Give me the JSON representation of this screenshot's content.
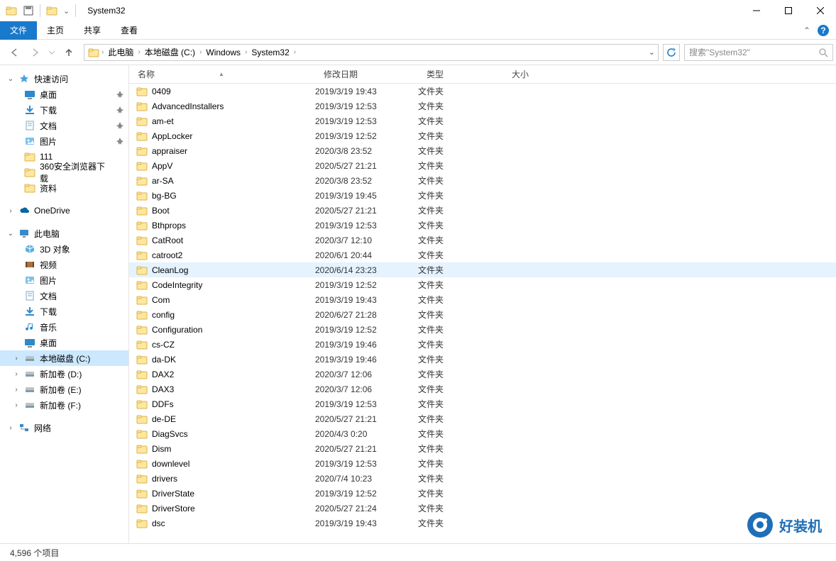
{
  "window": {
    "title": "System32"
  },
  "ribbon": {
    "file": "文件",
    "home": "主页",
    "share": "共享",
    "view": "查看"
  },
  "nav": {
    "breadcrumb": [
      "此电脑",
      "本地磁盘 (C:)",
      "Windows",
      "System32"
    ],
    "search_placeholder": "搜索\"System32\""
  },
  "sidebar": {
    "quick": {
      "label": "快速访问",
      "items": [
        {
          "label": "桌面",
          "icon": "desktop",
          "pinned": true
        },
        {
          "label": "下载",
          "icon": "downloads",
          "pinned": true
        },
        {
          "label": "文档",
          "icon": "documents",
          "pinned": true
        },
        {
          "label": "图片",
          "icon": "pictures",
          "pinned": true
        },
        {
          "label": "111",
          "icon": "folder",
          "pinned": false
        },
        {
          "label": "360安全浏览器下载",
          "icon": "folder",
          "pinned": false
        },
        {
          "label": "资料",
          "icon": "folder",
          "pinned": false
        }
      ]
    },
    "onedrive": {
      "label": "OneDrive"
    },
    "thispc": {
      "label": "此电脑",
      "items": [
        {
          "label": "3D 对象",
          "icon": "3d"
        },
        {
          "label": "视频",
          "icon": "video"
        },
        {
          "label": "图片",
          "icon": "pictures"
        },
        {
          "label": "文档",
          "icon": "documents"
        },
        {
          "label": "下载",
          "icon": "downloads"
        },
        {
          "label": "音乐",
          "icon": "music"
        },
        {
          "label": "桌面",
          "icon": "desktop"
        },
        {
          "label": "本地磁盘 (C:)",
          "icon": "drive",
          "selected": true
        },
        {
          "label": "新加卷 (D:)",
          "icon": "drive"
        },
        {
          "label": "新加卷 (E:)",
          "icon": "drive"
        },
        {
          "label": "新加卷 (F:)",
          "icon": "drive"
        }
      ]
    },
    "network": {
      "label": "网络"
    }
  },
  "columns": {
    "name": "名称",
    "date": "修改日期",
    "type": "类型",
    "size": "大小"
  },
  "rows": [
    {
      "name": "0409",
      "date": "2019/3/19 19:43",
      "type": "文件夹"
    },
    {
      "name": "AdvancedInstallers",
      "date": "2019/3/19 12:53",
      "type": "文件夹"
    },
    {
      "name": "am-et",
      "date": "2019/3/19 12:53",
      "type": "文件夹"
    },
    {
      "name": "AppLocker",
      "date": "2019/3/19 12:52",
      "type": "文件夹"
    },
    {
      "name": "appraiser",
      "date": "2020/3/8 23:52",
      "type": "文件夹"
    },
    {
      "name": "AppV",
      "date": "2020/5/27 21:21",
      "type": "文件夹"
    },
    {
      "name": "ar-SA",
      "date": "2020/3/8 23:52",
      "type": "文件夹"
    },
    {
      "name": "bg-BG",
      "date": "2019/3/19 19:45",
      "type": "文件夹"
    },
    {
      "name": "Boot",
      "date": "2020/5/27 21:21",
      "type": "文件夹"
    },
    {
      "name": "Bthprops",
      "date": "2019/3/19 12:53",
      "type": "文件夹"
    },
    {
      "name": "CatRoot",
      "date": "2020/3/7 12:10",
      "type": "文件夹"
    },
    {
      "name": "catroot2",
      "date": "2020/6/1 20:44",
      "type": "文件夹"
    },
    {
      "name": "CleanLog",
      "date": "2020/6/14 23:23",
      "type": "文件夹",
      "hover": true
    },
    {
      "name": "CodeIntegrity",
      "date": "2019/3/19 12:52",
      "type": "文件夹"
    },
    {
      "name": "Com",
      "date": "2019/3/19 19:43",
      "type": "文件夹"
    },
    {
      "name": "config",
      "date": "2020/6/27 21:28",
      "type": "文件夹"
    },
    {
      "name": "Configuration",
      "date": "2019/3/19 12:52",
      "type": "文件夹"
    },
    {
      "name": "cs-CZ",
      "date": "2019/3/19 19:46",
      "type": "文件夹"
    },
    {
      "name": "da-DK",
      "date": "2019/3/19 19:46",
      "type": "文件夹"
    },
    {
      "name": "DAX2",
      "date": "2020/3/7 12:06",
      "type": "文件夹"
    },
    {
      "name": "DAX3",
      "date": "2020/3/7 12:06",
      "type": "文件夹"
    },
    {
      "name": "DDFs",
      "date": "2019/3/19 12:53",
      "type": "文件夹"
    },
    {
      "name": "de-DE",
      "date": "2020/5/27 21:21",
      "type": "文件夹"
    },
    {
      "name": "DiagSvcs",
      "date": "2020/4/3 0:20",
      "type": "文件夹"
    },
    {
      "name": "Dism",
      "date": "2020/5/27 21:21",
      "type": "文件夹"
    },
    {
      "name": "downlevel",
      "date": "2019/3/19 12:53",
      "type": "文件夹"
    },
    {
      "name": "drivers",
      "date": "2020/7/4 10:23",
      "type": "文件夹"
    },
    {
      "name": "DriverState",
      "date": "2019/3/19 12:52",
      "type": "文件夹"
    },
    {
      "name": "DriverStore",
      "date": "2020/5/27 21:24",
      "type": "文件夹"
    },
    {
      "name": "dsc",
      "date": "2019/3/19 19:43",
      "type": "文件夹"
    }
  ],
  "status": {
    "count": "4,596 个项目"
  },
  "watermark": "好装机"
}
